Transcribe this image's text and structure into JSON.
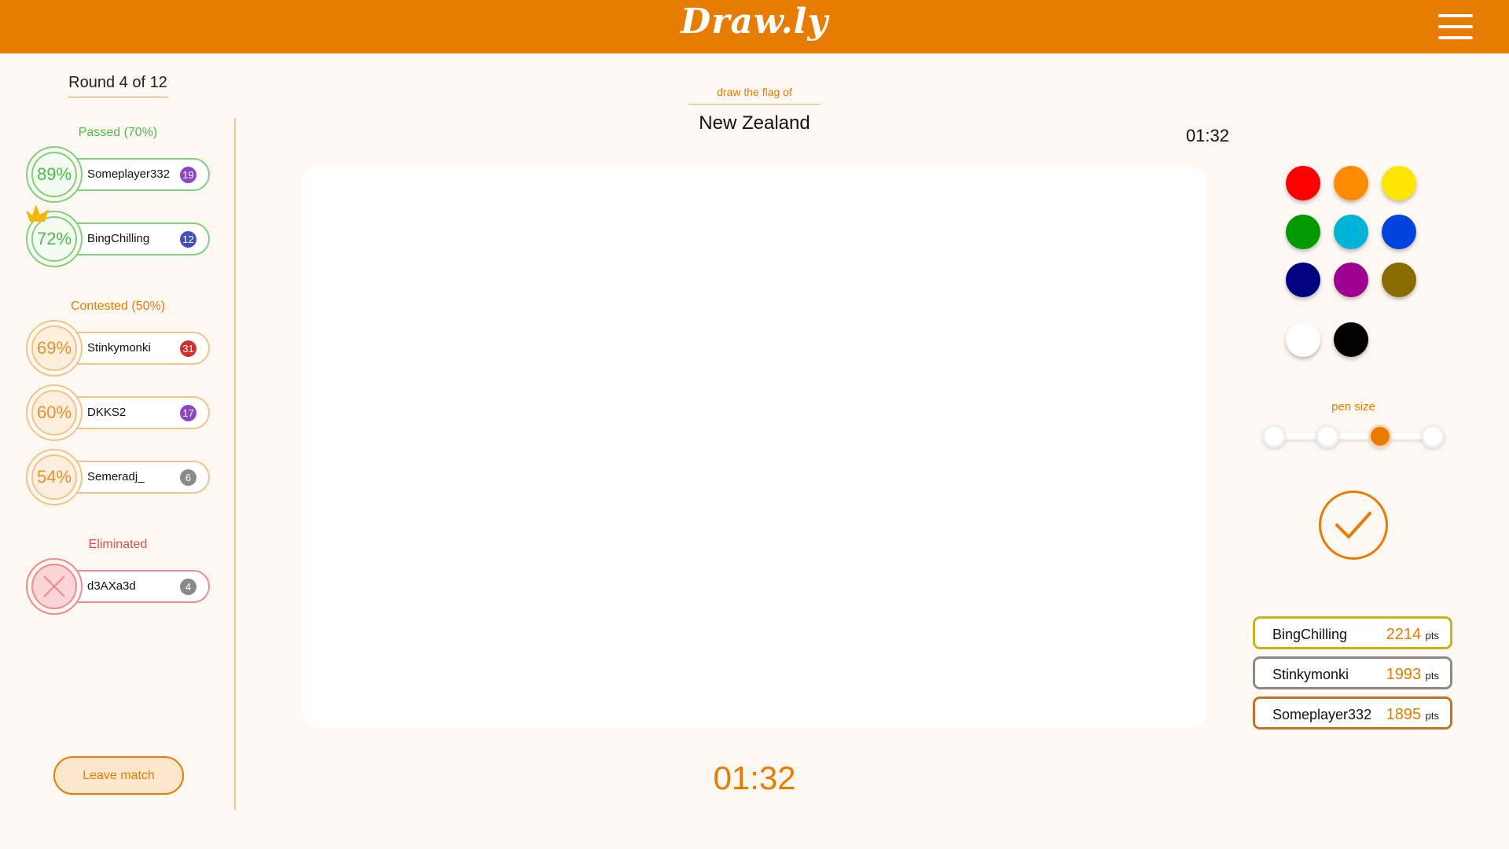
{
  "header": {
    "logo": "Draw.ly",
    "menu_icon": "hamburger-menu-icon",
    "color": "#e77c00"
  },
  "round": "Round 4 of 12",
  "sections": {
    "passed": "Passed (70%)",
    "contested": "Contested (50%)",
    "eliminated": "Eliminated"
  },
  "players": {
    "passed": [
      {
        "pct": "89%",
        "name": "Someplayer332",
        "count": "19",
        "badge_color": "#8e44c6"
      },
      {
        "pct": "72%",
        "name": "BingChilling",
        "count": "12",
        "badge_color": "#3f51b5",
        "crown": true
      }
    ],
    "contested": [
      {
        "pct": "69%",
        "name": "Stinkymonki",
        "count": "31",
        "badge_color": "#d32f2f"
      },
      {
        "pct": "60%",
        "name": "DKKS2",
        "count": "17",
        "badge_color": "#8e44c6"
      },
      {
        "pct": "54%",
        "name": "Semeradj_",
        "count": "6",
        "badge_color": "#8a8a8a"
      }
    ],
    "eliminated": [
      {
        "name": "d3AXa3d",
        "count": "4",
        "badge_color": "#8a8a8a"
      }
    ]
  },
  "leave_button": "Leave match",
  "prompt": {
    "hint": "draw the flag of",
    "country": "New Zealand"
  },
  "timer": "01:32",
  "palette": [
    "#ff0000",
    "#ff8c00",
    "#ffe600",
    "#009900",
    "#00b4d8",
    "#0044dd",
    "#000080",
    "#a0008f",
    "#8b6a00",
    "#ffffff",
    "#000000"
  ],
  "pen_size": {
    "label": "pen size",
    "levels": 4,
    "selected_index": 2
  },
  "leaderboard": [
    {
      "name": "BingChilling",
      "points": "2214",
      "unit": "pts",
      "border": "#c8b21c"
    },
    {
      "name": "Stinkymonki",
      "points": "1993",
      "unit": "pts",
      "border": "#8a8a8a"
    },
    {
      "name": "Someplayer332",
      "points": "1895",
      "unit": "pts",
      "border": "#c0732a"
    }
  ]
}
